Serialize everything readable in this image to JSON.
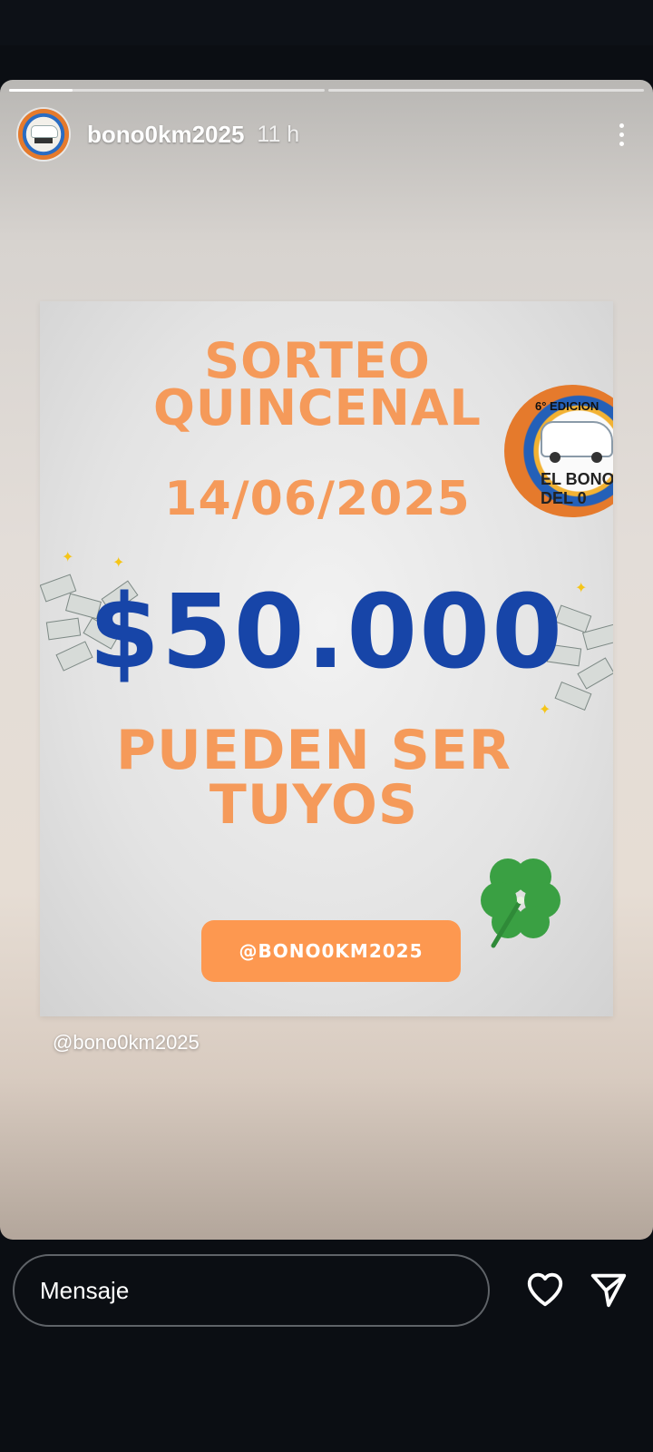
{
  "story": {
    "progress_segments": [
      1,
      0
    ],
    "username": "bono0km2025",
    "time_ago": "11 h",
    "caption_mention": "@bono0km2025"
  },
  "post": {
    "title_line_1": "SORTEO",
    "title_line_2": "QUINCENAL",
    "date": "14/06/2025",
    "amount": "$50.000",
    "tagline_1": "PUEDEN SER",
    "tagline_2": "TUYOS",
    "handle": "@BONO0KM2025",
    "logo_text_edition": "6° EDICION",
    "logo_text_brand": "EL BONO DEL 0"
  },
  "reply_bar": {
    "placeholder": "Mensaje"
  },
  "colors": {
    "title_orange": "#f59a5a",
    "amount_blue": "#1745a8",
    "pill_orange": "#fd9850"
  },
  "icons": [
    "more-icon",
    "heart-icon",
    "send-icon",
    "clover-icon"
  ]
}
